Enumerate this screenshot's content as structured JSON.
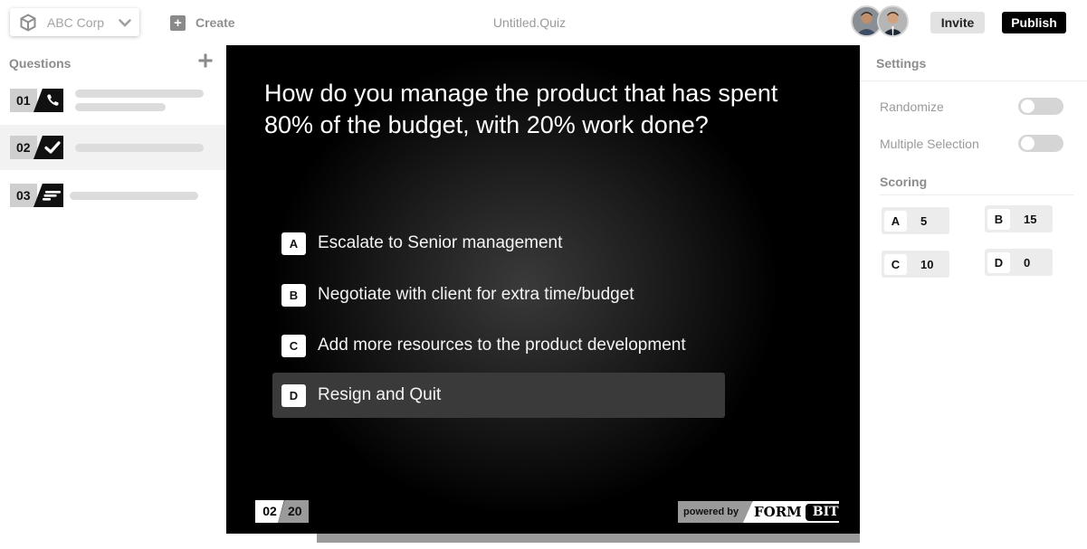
{
  "topbar": {
    "workspace": {
      "name": "ABC Corp",
      "icon": "cube-icon"
    },
    "create_label": "Create",
    "doc_title": "Untitled.Quiz",
    "invite_label": "Invite",
    "publish_label": "Publish"
  },
  "sidebar": {
    "title": "Questions",
    "items": [
      {
        "number": "01",
        "icon": "phone-icon",
        "selected": false
      },
      {
        "number": "02",
        "icon": "checkmark-icon",
        "selected": true
      },
      {
        "number": "03",
        "icon": "text-lines-icon",
        "selected": false
      }
    ]
  },
  "question": {
    "text": "How do you manage the product that has spent 80% of the budget, with 20% work done?",
    "options": [
      {
        "key": "A",
        "text": "Escalate to Senior management",
        "selected": false
      },
      {
        "key": "B",
        "text": "Negotiate with client for extra time/budget",
        "selected": false
      },
      {
        "key": "C",
        "text": "Add more resources to the product development",
        "selected": false
      },
      {
        "key": "D",
        "text": "Resign and Quit",
        "selected": true
      }
    ],
    "counter": {
      "current": "02",
      "total": "20"
    },
    "powered_by": {
      "label": "powered by",
      "brand_form": "FORM",
      "brand_bit": "BIT"
    }
  },
  "settings": {
    "title": "Settings",
    "toggles": [
      {
        "label": "Randomize",
        "on": false
      },
      {
        "label": "Multiple Selection",
        "on": false
      }
    ],
    "scoring_title": "Scoring",
    "scores": [
      {
        "key": "A",
        "value": "5"
      },
      {
        "key": "B",
        "value": "15"
      },
      {
        "key": "C",
        "value": "10"
      },
      {
        "key": "D",
        "value": "0"
      }
    ]
  },
  "progress": {
    "fraction": 0.1
  },
  "colors": {
    "accent": "#000000",
    "stage_bg": "#000000",
    "muted": "#9a9a9a"
  }
}
